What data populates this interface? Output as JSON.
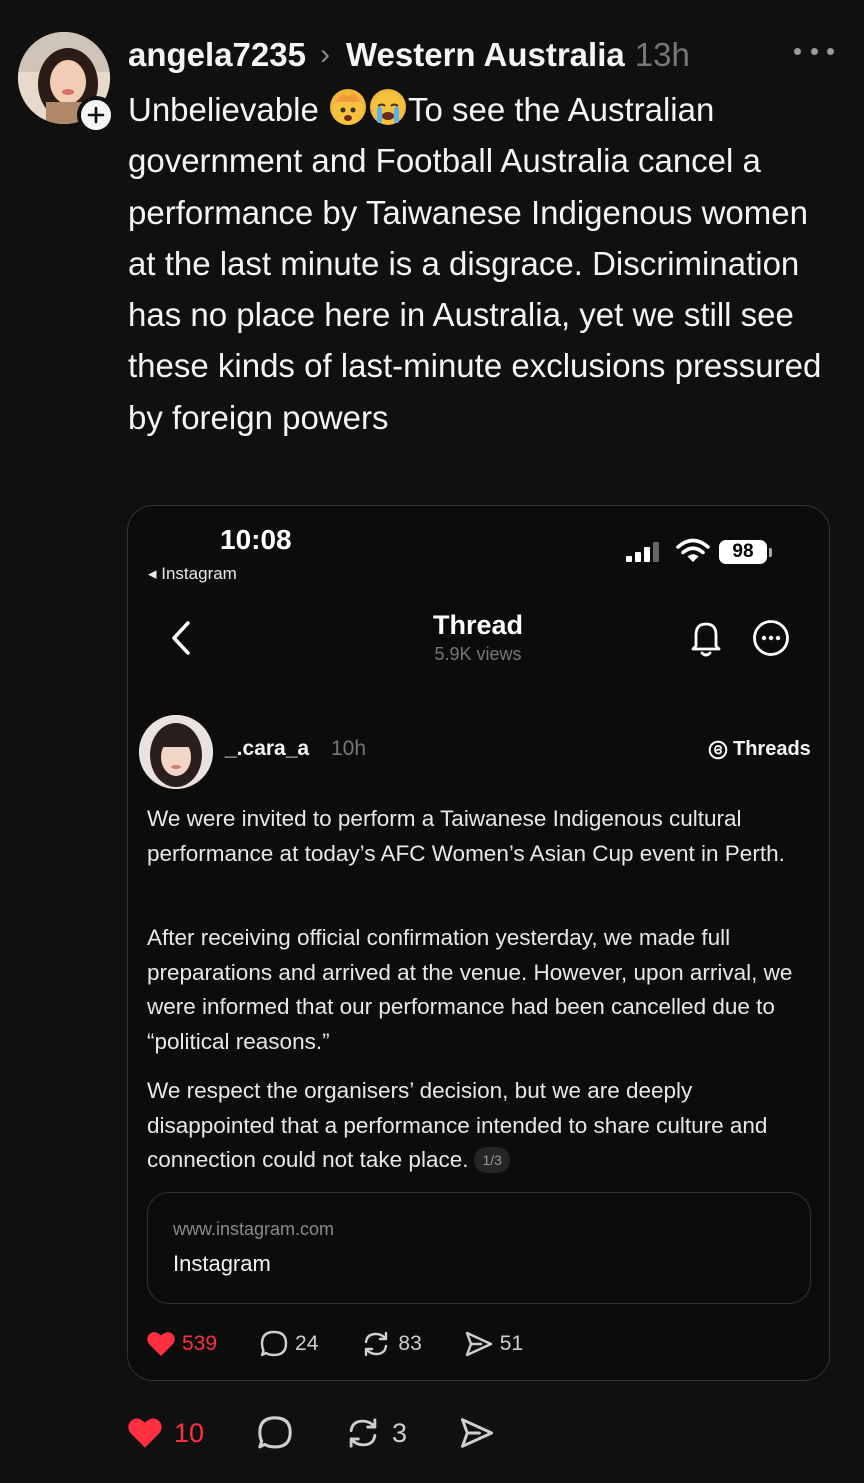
{
  "post": {
    "username": "angela7235",
    "location": "Western Australia",
    "time": "13h",
    "text_part1": "Unbelievable ",
    "text_part2": "To see the Australian government and Football Australia cancel a performance by Taiwanese Indigenous women at the last minute is a disgrace. Discrimination has no place here in Australia, yet we still see these kinds of last-minute exclusions pressured by foreign powers",
    "emojis": [
      "exploding-head-emoji",
      "crying-face-emoji"
    ],
    "likes": "10",
    "comments": "",
    "reposts": "3"
  },
  "screenshot": {
    "status_time": "10:08",
    "back_app": "◂ Instagram",
    "battery": "98",
    "nav_title": "Thread",
    "nav_views": "5.9K views",
    "author": "_.cara_a",
    "author_time": "10h",
    "threads_label": "Threads",
    "paragraphs": [
      "We were invited to perform a Taiwanese Indigenous cultural performance at today’s AFC Women’s Asian Cup event in Perth.",
      "After receiving official confirmation yesterday, we made full preparations and arrived at the venue. However, upon arrival, we were informed that our performance had been cancelled due to “political reasons.”",
      "We respect the organisers’ decision, but we are deeply disappointed that a performance intended to share culture and connection could not take place."
    ],
    "pager": "1/3",
    "link_domain": "www.instagram.com",
    "link_title": "Instagram",
    "likes": "539",
    "comments": "24",
    "reposts": "83",
    "shares": "51"
  },
  "colors": {
    "background": "#101010",
    "like_red": "#ff3040",
    "muted": "#777777"
  }
}
